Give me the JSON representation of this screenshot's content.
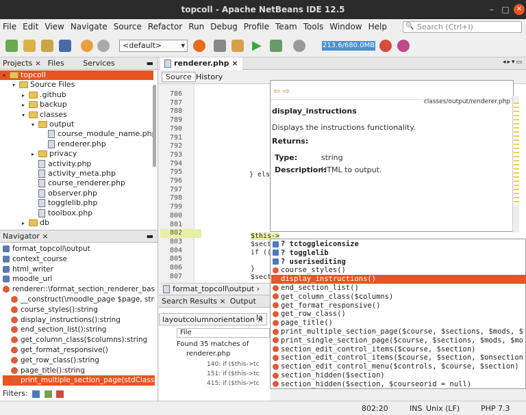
{
  "window": {
    "title": "topcoll - Apache NetBeans IDE 12.5"
  },
  "menu": [
    "File",
    "Edit",
    "View",
    "Navigate",
    "Source",
    "Refactor",
    "Run",
    "Debug",
    "Profile",
    "Team",
    "Tools",
    "Window",
    "Help"
  ],
  "search": {
    "placeholder": "Search (Ctrl+I)"
  },
  "toolbar": {
    "config": "<default>",
    "memory": "213.6/680.0MB"
  },
  "projects": {
    "tabs": [
      "Projects",
      "Files",
      "Services"
    ],
    "items": [
      {
        "label": "topcoll",
        "indent": 0,
        "type": "project",
        "arrow": "▾"
      },
      {
        "label": "Source Files",
        "indent": 1,
        "type": "folder",
        "arrow": "▾"
      },
      {
        "label": ".github",
        "indent": 2,
        "type": "folder",
        "arrow": "▸"
      },
      {
        "label": "backup",
        "indent": 2,
        "type": "folder",
        "arrow": "▸"
      },
      {
        "label": "classes",
        "indent": 2,
        "type": "folder",
        "arrow": "▾"
      },
      {
        "label": "output",
        "indent": 3,
        "type": "folder",
        "arrow": "▾"
      },
      {
        "label": "course_module_name.php",
        "indent": 4,
        "type": "file",
        "arrow": ""
      },
      {
        "label": "renderer.php",
        "indent": 4,
        "type": "file",
        "arrow": ""
      },
      {
        "label": "privacy",
        "indent": 3,
        "type": "folder",
        "arrow": "▸"
      },
      {
        "label": "activity.php",
        "indent": 3,
        "type": "file",
        "arrow": ""
      },
      {
        "label": "activity_meta.php",
        "indent": 3,
        "type": "file",
        "arrow": ""
      },
      {
        "label": "course_renderer.php",
        "indent": 3,
        "type": "file",
        "arrow": ""
      },
      {
        "label": "observer.php",
        "indent": 3,
        "type": "file",
        "arrow": ""
      },
      {
        "label": "togglelib.php",
        "indent": 3,
        "type": "file",
        "arrow": ""
      },
      {
        "label": "toolbox.php",
        "indent": 3,
        "type": "file",
        "arrow": ""
      },
      {
        "label": "db",
        "indent": 2,
        "type": "folder",
        "arrow": "▸"
      }
    ]
  },
  "navigator": {
    "title": "Navigator",
    "items": [
      "format_topcoll\\output",
      "context_course",
      "html_writer",
      "moodle_url",
      "renderer::\\format_section_renderer_bas",
      "__construct(\\moodle_page $page, strir",
      "course_styles():string",
      "display_instructions():string",
      "end_section_list():string",
      "get_column_class($columns):string",
      "get_format_responsive()",
      "get_row_class():string",
      "page_title():string",
      "print_multiple_section_page(stdClass $"
    ],
    "filters": "Filters:"
  },
  "editor": {
    "tab": "renderer.php",
    "source_tab": "Source",
    "history_tab": "History",
    "lines": [
      "786",
      "787",
      "788",
      "789",
      "790",
      "791",
      "792",
      "793",
      "794",
      "795",
      "796",
      "797",
      "798",
      "799",
      "800",
      "801",
      "802",
      "803",
      "804",
      "805",
      "806",
      "807"
    ],
    "code_else": "} els",
    "code_this": "$this->",
    "code_sect": "$sect",
    "code_if": "if ((",
    "code_brace": "}",
    "code_sect2": "$sect",
    "breadcrumb": "format_topcoll\\output"
  },
  "doc": {
    "path": "classes/output/renderer.php",
    "name": "display_instructions",
    "desc": "Displays the instructions functionality.",
    "returns": "Returns:",
    "type_label": "Type:",
    "type_val": "string",
    "desc_label": "Description:",
    "desc_val": "HTML to output."
  },
  "completion": [
    {
      "text": "? tctoggleiconsize",
      "bold": true,
      "sel": false
    },
    {
      "text": "? togglelib",
      "bold": true,
      "sel": false
    },
    {
      "text": "? userisediting",
      "bold": true,
      "sel": false
    },
    {
      "text": "course_styles()",
      "bold": false,
      "sel": false
    },
    {
      "text": "display_instructions()",
      "bold": false,
      "sel": true
    },
    {
      "text": "end_section_list()",
      "bold": false,
      "sel": false
    },
    {
      "text": "get_column_class($columns)",
      "bold": false,
      "sel": false
    },
    {
      "text": "get_format_responsive()",
      "bold": false,
      "sel": false
    },
    {
      "text": "get_row_class()",
      "bold": false,
      "sel": false
    },
    {
      "text": "page_title()",
      "bold": false,
      "sel": false
    },
    {
      "text": "print_multiple_section_page($course, $sections, $mods, $",
      "bold": false,
      "sel": false
    },
    {
      "text": "print_single_section_page($course, $sections, $mods, $mo",
      "bold": false,
      "sel": false
    },
    {
      "text": "section_edit_control_items($course, $section)",
      "bold": false,
      "sel": false
    },
    {
      "text": "section_edit_control_items($course, $section, $onsection",
      "bold": false,
      "sel": false
    },
    {
      "text": "section_edit_control_menu($controls, $course, $section)",
      "bold": false,
      "sel": false
    },
    {
      "text": "section_hidden($section)",
      "bold": false,
      "sel": false
    },
    {
      "text": "section_hidden($section, $courseorid = null)",
      "bold": false,
      "sel": false
    }
  ],
  "search_results": {
    "tabs": [
      "Search Results",
      "Output"
    ],
    "subtab": "layoutcolumnorientation",
    "subtab2": "la",
    "scope": "File",
    "found": "Found 35 matches of",
    "file": "renderer.php",
    "rows": [
      "140: if ($this->tc",
      "151: if ($this->tc",
      "415: if ($this->tc"
    ]
  },
  "status": {
    "pos": "802:20",
    "mode": "INS",
    "eol": "Unix (LF)",
    "lang": "PHP 7.3"
  }
}
